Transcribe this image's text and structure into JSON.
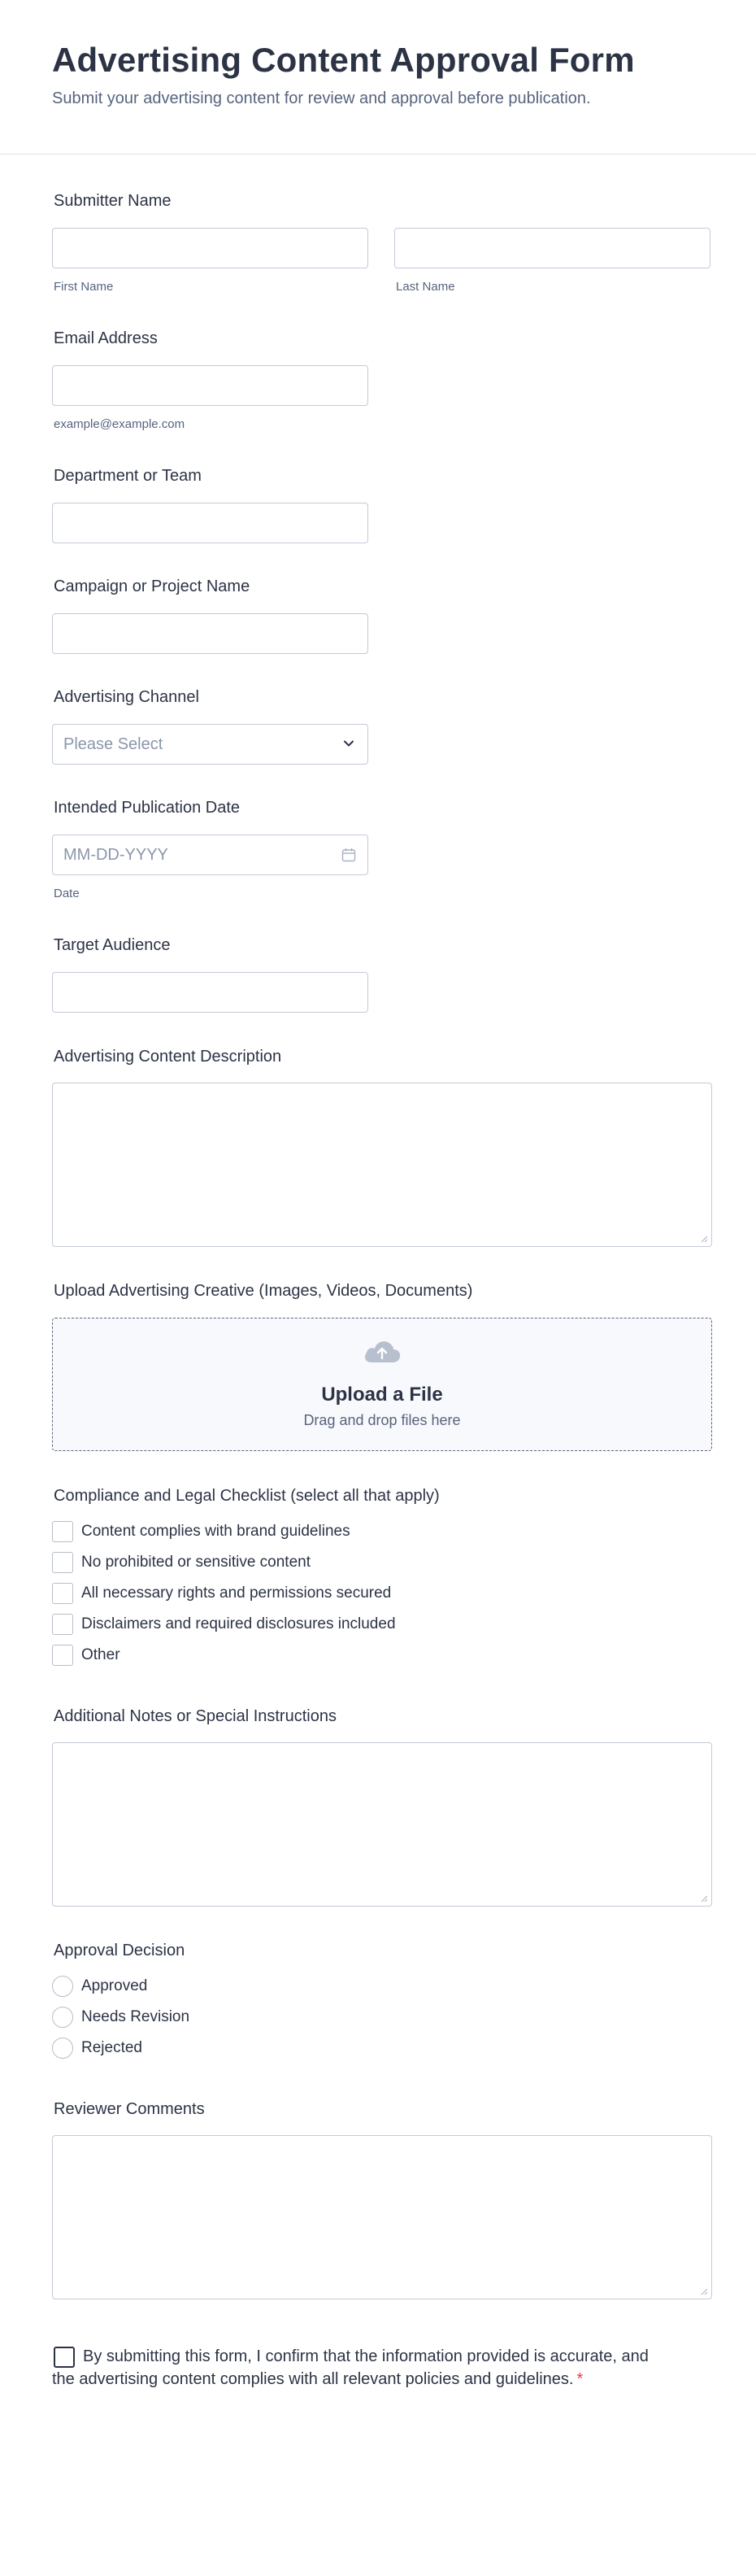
{
  "form": {
    "title": "Advertising Content Approval Form",
    "subtitle": "Submit your advertising content for review and approval before publication."
  },
  "submitter": {
    "label": "Submitter Name",
    "first_sublabel": "First Name",
    "last_sublabel": "Last Name"
  },
  "email": {
    "label": "Email Address",
    "sublabel": "example@example.com"
  },
  "department": {
    "label": "Department or Team"
  },
  "campaign": {
    "label": "Campaign or Project Name"
  },
  "channel": {
    "label": "Advertising Channel",
    "placeholder": "Please Select",
    "icon": "chevron-down-icon"
  },
  "pub_date": {
    "label": "Intended Publication Date",
    "placeholder": "MM-DD-YYYY",
    "sublabel": "Date",
    "icon": "calendar-icon"
  },
  "audience": {
    "label": "Target Audience"
  },
  "description": {
    "label": "Advertising Content Description"
  },
  "upload": {
    "label": "Upload Advertising Creative (Images, Videos, Documents)",
    "title": "Upload a File",
    "subtitle": "Drag and drop files here",
    "icon": "cloud-upload-icon"
  },
  "checklist": {
    "label": "Compliance and Legal Checklist (select all that apply)",
    "options": [
      "Content complies with brand guidelines",
      "No prohibited or sensitive content",
      "All necessary rights and permissions secured",
      "Disclaimers and required disclosures included",
      "Other"
    ]
  },
  "notes": {
    "label": "Additional Notes or Special Instructions"
  },
  "decision": {
    "label": "Approval Decision",
    "options": [
      "Approved",
      "Needs Revision",
      "Rejected"
    ]
  },
  "comments": {
    "label": "Reviewer Comments"
  },
  "consent": {
    "text": "By submitting this form, I confirm that the information provided is accurate, and the advertising content complies with all relevant policies and guidelines.",
    "required_mark": "*"
  },
  "colors": {
    "text": "#2c3345",
    "muted": "#57647e",
    "border": "#c3cad8",
    "required": "#f23a3c",
    "upload_bg": "#f8f9fc"
  }
}
